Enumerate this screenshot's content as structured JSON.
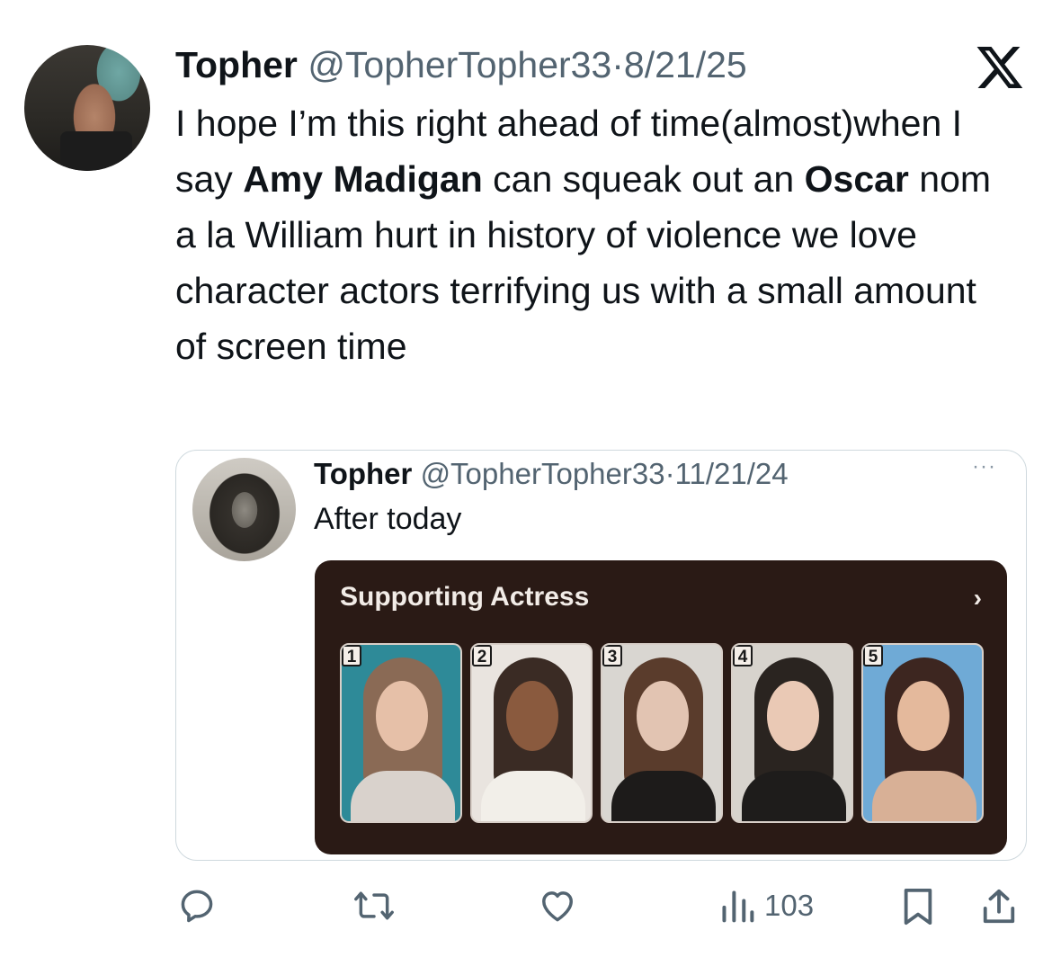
{
  "tweet": {
    "author": "Topher",
    "handle": "@TopherTopher33",
    "separator": "·",
    "date": "8/21/25",
    "text_parts": [
      {
        "t": "I hope I’m this right ahead of time(almost)when I say ",
        "bold": false
      },
      {
        "t": "Amy Madigan",
        "bold": true
      },
      {
        "t": " can squeak out an ",
        "bold": false
      },
      {
        "t": "Oscar",
        "bold": true
      },
      {
        "t": " nom a la William hurt in history of violence we love character actors terrifying us with a  small amount of screen time",
        "bold": false
      }
    ]
  },
  "quote": {
    "author": "Topher",
    "handle": "@TopherTopher33",
    "separator": "·",
    "date": "11/21/24",
    "more": "···",
    "text": "After today",
    "media": {
      "title": "Supporting Actress",
      "chevron": "›",
      "cards": [
        {
          "rank": "1",
          "bg": "#2e8a98",
          "skin": "#e6c0a8",
          "hair": "#8a6a55",
          "top": "#d9d2cc"
        },
        {
          "rank": "2",
          "bg": "#e9e4df",
          "skin": "#8a5a3e",
          "hair": "#3a2b24",
          "top": "#f2efe9"
        },
        {
          "rank": "3",
          "bg": "#d9d6d1",
          "skin": "#e2c4b2",
          "hair": "#5a3c2c",
          "top": "#1d1b1a"
        },
        {
          "rank": "4",
          "bg": "#d7d3cd",
          "skin": "#eac9b5",
          "hair": "#2a2420",
          "top": "#1e1c1b"
        },
        {
          "rank": "5",
          "bg": "#6faad6",
          "skin": "#e4b99c",
          "hair": "#3d2620",
          "top": "#d8b096"
        }
      ]
    }
  },
  "actions": {
    "views": "103",
    "icons": [
      "reply-icon",
      "retweet-icon",
      "like-icon",
      "views-icon",
      "bookmark-icon",
      "share-icon"
    ]
  },
  "colors": {
    "text": "#0f1419",
    "secondary": "#536471",
    "border": "#cfd9de",
    "media_bg": "#2a1a15"
  }
}
